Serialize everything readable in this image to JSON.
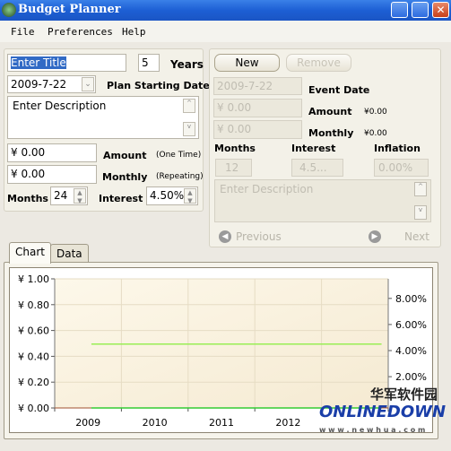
{
  "window": {
    "title": "Budget Planner",
    "icon": "app-globe-icon"
  },
  "menu": [
    "File",
    "Preferences",
    "Help"
  ],
  "plan": {
    "title_value": "Enter Title",
    "years_value": "5",
    "years_label": "Years",
    "start_date": "2009-7-22",
    "start_date_label": "Plan Starting Date",
    "description": "Enter Description",
    "amount_value": "¥ 0.00",
    "amount_label": "Amount",
    "amount_note": "(One Time)",
    "monthly_value": "¥ 0.00",
    "monthly_label": "Monthly",
    "monthly_note": "(Repeating)",
    "months_label": "Months",
    "months_value": "24",
    "interest_label": "Interest",
    "interest_value": "4.50%"
  },
  "event": {
    "new_label": "New",
    "remove_label": "Remove",
    "date_value": "2009-7-22",
    "date_label": "Event Date",
    "amount_value": "¥ 0.00",
    "amount_label": "Amount",
    "amount_display": "¥0.00",
    "monthly_value": "¥ 0.00",
    "monthly_label": "Monthly",
    "monthly_display": "¥0.00",
    "months_label": "Months",
    "interest_label": "Interest",
    "inflation_label": "Inflation",
    "months_value": "12",
    "interest_value": "4.5...",
    "inflation_value": "0.00%",
    "description": "Enter Description",
    "previous_label": "Previous",
    "next_label": "Next"
  },
  "tabs": [
    {
      "label": "Chart",
      "active": true
    },
    {
      "label": "Data",
      "active": false
    }
  ],
  "chart_data": {
    "type": "line",
    "x_ticks": [
      "2009",
      "2010",
      "2011",
      "2012"
    ],
    "y_left_ticks": [
      "¥ 0.00",
      "¥ 0.20",
      "¥ 0.40",
      "¥ 0.60",
      "¥ 0.80",
      "¥ 1.00"
    ],
    "y_left_range": [
      0,
      1
    ],
    "y_right_ticks": [
      "2.00%",
      "4.00%",
      "6.00%",
      "8.00%"
    ],
    "y_right_range": [
      -0.4,
      9.5
    ],
    "grid": true,
    "series": [
      {
        "axis": "left",
        "color": "#33cc33",
        "x": [
          2009.55,
          2013.9
        ],
        "values": [
          0,
          0
        ]
      },
      {
        "axis": "right",
        "color": "#99ee55",
        "x": [
          2009.55,
          2013.9
        ],
        "values": [
          4.5,
          4.5
        ]
      }
    ]
  },
  "watermark": {
    "text": "华军软件园 ONLINEDOWN www.newhua.com"
  }
}
